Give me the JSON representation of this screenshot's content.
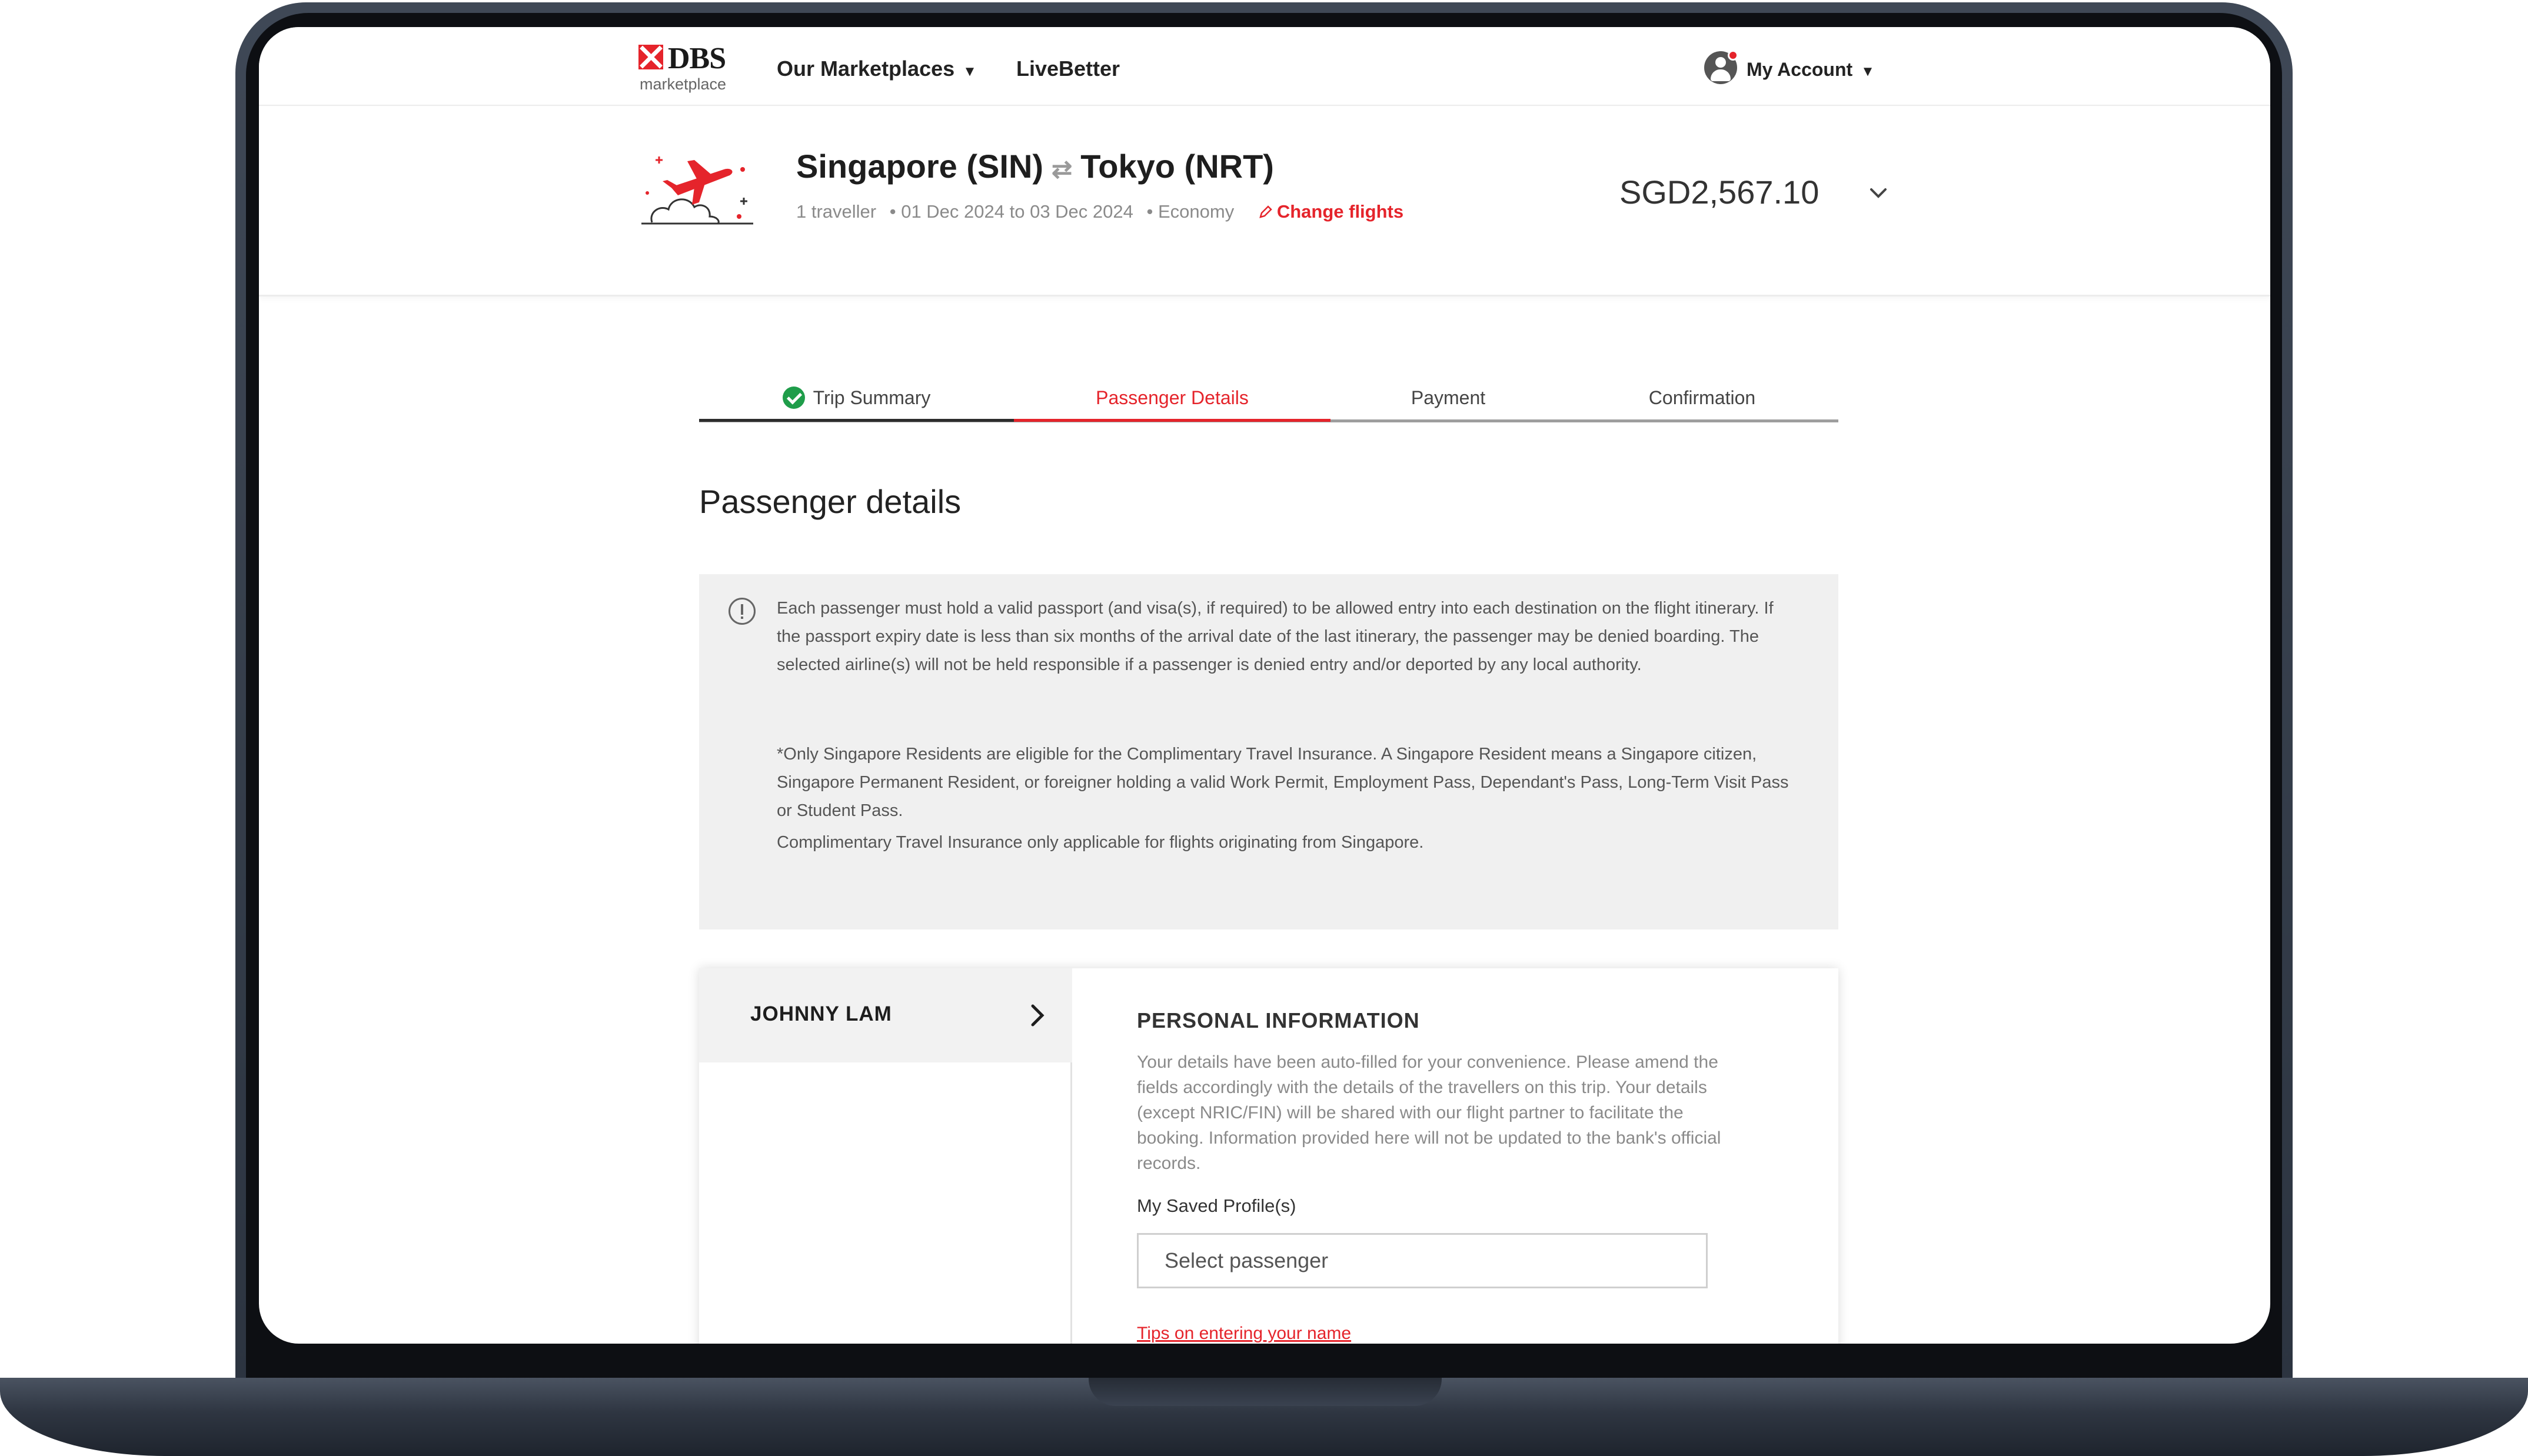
{
  "brand": {
    "name": "DBS",
    "subtitle": "marketplace",
    "accent_color": "#e5242b"
  },
  "nav": {
    "marketplaces_label": "Our Marketplaces",
    "livebetter_label": "LiveBetter",
    "account_label": "My Account",
    "caret": "▼"
  },
  "flight": {
    "origin": "Singapore (SIN)",
    "swap_icon": "⇄",
    "destination": "Tokyo (NRT)",
    "travellers": "1 traveller",
    "dates": "• 01 Dec 2024 to 03 Dec 2024",
    "cabin": "• Economy",
    "change_label": "Change flights",
    "price": "SGD2,567.10"
  },
  "steps": [
    {
      "label": "Trip Summary",
      "state": "done"
    },
    {
      "label": "Passenger Details",
      "state": "active"
    },
    {
      "label": "Payment",
      "state": "pending"
    },
    {
      "label": "Confirmation",
      "state": "pending"
    }
  ],
  "page_title": "Passenger details",
  "notice": {
    "passport": "Each passenger must hold a valid passport (and visa(s), if required) to be allowed entry into each destination on the flight itinerary. If the passport expiry date is less than six months of the arrival date of the last itinerary, the passenger may be denied boarding. The selected airline(s) will not be held responsible if a passenger is denied entry and/or deported by any local authority.",
    "insurance": "*Only Singapore Residents are eligible for the Complimentary Travel Insurance. A Singapore Resident means a Singapore citizen, Singapore Permanent Resident, or foreigner holding a valid Work Permit, Employment Pass, Dependant's Pass, Long-Term Visit Pass or Student Pass.",
    "origin_rule": "Complimentary Travel Insurance only applicable for flights originating from Singapore."
  },
  "passenger": {
    "name": "JOHNNY LAM"
  },
  "personal_info": {
    "heading": "PERSONAL INFORMATION",
    "description": "Your details have been auto-filled for your convenience. Please amend the fields accordingly with the details of the travellers on this trip. Your details (except NRIC/FIN) will be shared with our flight partner to facilitate the booking. Information provided here will not be updated to the bank's official records.",
    "saved_profiles_label": "My Saved Profile(s)",
    "select_placeholder": "Select passenger",
    "tips_link": "Tips on entering your name"
  }
}
